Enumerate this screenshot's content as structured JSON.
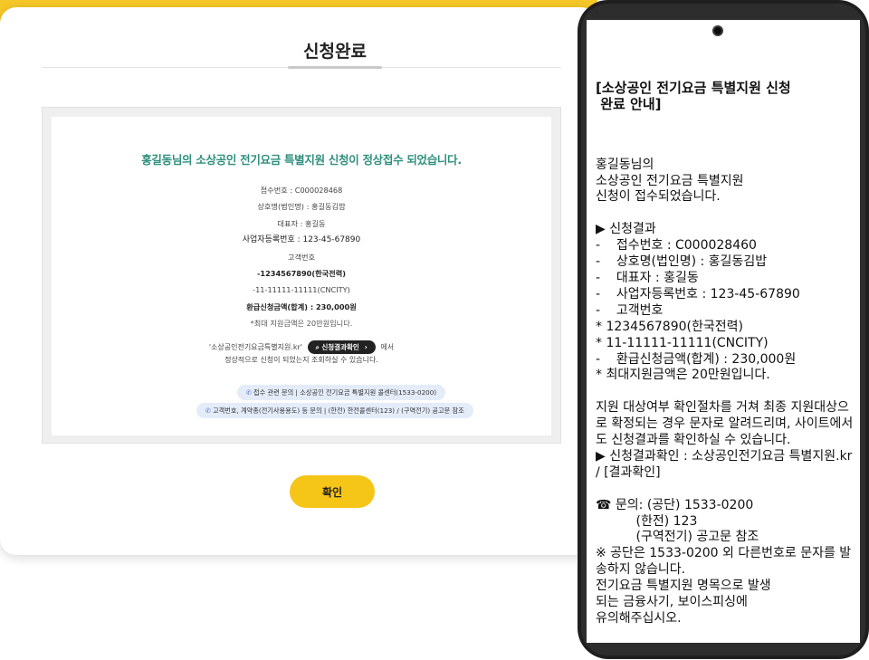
{
  "web": {
    "title": "신청완료",
    "headline": "홍길동님의 소상공인 전기요금 특별지원 신청이 정상접수 되었습니다.",
    "receipt": "접수번호 : C000028468",
    "business": "상호명(법인명) : 홍길동김밥",
    "representative": "대표자 : 홍길동",
    "bizno": "사업자등록번호 : 123-45-67890",
    "customer_label": "고객번호",
    "customer1": "-1234567890(한국전력)",
    "customer2": "-11-11111-11111(CNCITY)",
    "refund": "환급신청금액(합계) : 230,000원",
    "max_note": "*최대 지원금액은 20만원입니다.",
    "site_before": "'소상공인전기요금특별지원.kr'",
    "site_pill": "신청결과확인",
    "site_after": "에서",
    "site_sub": "정상적으로 신청이 되었는지 조회하실 수 있습니다.",
    "contact1": "접수 관련 문의 | 소상공인 전기요금 특별지원 콜센터(1533-0200)",
    "contact2": "고객번호, 계약종(전기사용용도) 등 문의 | (한전) 한전콜센터(123) / (구역전기) 공고문 참조",
    "confirm_button": "확인"
  },
  "sms": {
    "title": "[소상공인 전기요금 특별지원 신청\n 완료 안내]",
    "body": "홍길동님의\n소상공인 전기요금 특별지원\n신청이 접수되었습니다.\n\n▶ 신청결과\n-    접수번호 : C000028460\n-    상호명(법인명) : 홍길동김밥\n-    대표자 : 홍길동\n-    사업자등록번호 : 123-45-67890\n-    고객번호\n* 1234567890(한국전력)\n* 11-11111-11111(CNCITY)\n-    환급신청금액(합계) : 230,000원\n* 최대지원금액은 20만원입니다.\n\n지원 대상여부 확인절차를 거쳐 최종 지원대상으로 확정되는 경우 문자로 알려드리며, 사이트에서도 신청결과를 확인하실 수 있습니다.\n▶ 신청결과확인 : 소상공인전기요금 특별지원.kr / [결과확인]\n\n☎ 문의: (공단) 1533-0200\n          (한전) 123\n          (구역전기) 공고문 참조\n※ 공단은 1533-0200 외 다른번호로 문자를 발송하지 않습니다.\n전기요금 특별지원 명목으로 발생\n되는 금융사기, 보이스피싱에\n유의해주십시오."
  },
  "colors": {
    "accent": "#f5c828",
    "headline": "#2f8f7d",
    "contact_bg": "#e4ecfa"
  },
  "icons": [
    "phone-icon",
    "search-icon",
    "chevron-right-icon",
    "camera-icon"
  ]
}
